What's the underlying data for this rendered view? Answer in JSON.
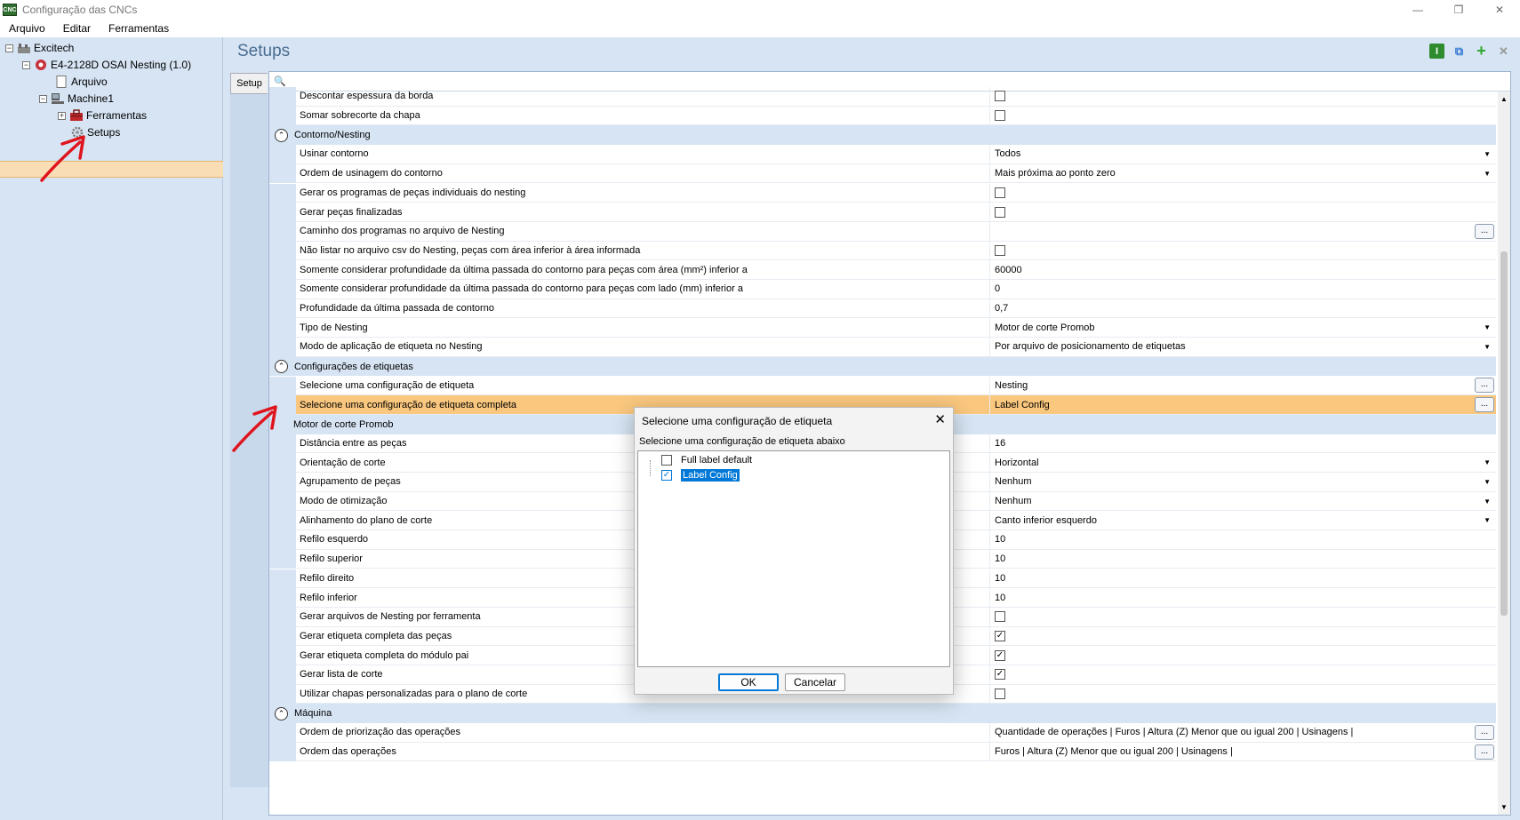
{
  "window": {
    "title": "Configuração das CNCs",
    "app_icon_text": "CNC"
  },
  "menu": [
    "Arquivo",
    "Editar",
    "Ferramentas"
  ],
  "tree": {
    "root": "Excitech",
    "machine": "E4-2128D OSAI Nesting (1.0)",
    "arquivo": "Arquivo",
    "machine1": "Machine1",
    "ferramentas": "Ferramentas",
    "setups": "Setups"
  },
  "header": {
    "title": "Setups"
  },
  "tab": {
    "label": "Setup"
  },
  "rows": [
    {
      "type": "prop",
      "label": "Descontar espessura da borda",
      "kind": "check",
      "checked": false
    },
    {
      "type": "prop",
      "label": "Somar sobrecorte da chapa",
      "kind": "check",
      "checked": false
    },
    {
      "type": "cat",
      "label": "Contorno/Nesting"
    },
    {
      "type": "prop",
      "label": "Usinar contorno",
      "kind": "dropdown",
      "value": "Todos"
    },
    {
      "type": "prop",
      "label": "Ordem de usinagem do contorno",
      "kind": "dropdown",
      "value": "Mais próxima ao ponto zero"
    },
    {
      "type": "prop",
      "label": "Gerar os programas de peças individuais do nesting",
      "kind": "check",
      "checked": false
    },
    {
      "type": "prop",
      "label": "Gerar peças finalizadas",
      "kind": "check",
      "checked": false
    },
    {
      "type": "prop",
      "label": "Caminho dos programas no arquivo de Nesting",
      "kind": "ellipsis",
      "value": ""
    },
    {
      "type": "prop",
      "label": "Não listar no arquivo csv do Nesting, peças com área inferior à área informada",
      "kind": "check",
      "checked": false
    },
    {
      "type": "prop",
      "label": "Somente considerar profundidade da última passada do contorno para peças com área (mm²) inferior a",
      "kind": "text",
      "value": "60000"
    },
    {
      "type": "prop",
      "label": "Somente considerar profundidade da última passada do contorno para peças com lado (mm) inferior a",
      "kind": "text",
      "value": "0"
    },
    {
      "type": "prop",
      "label": "Profundidade da última passada de contorno",
      "kind": "text",
      "value": "0,7"
    },
    {
      "type": "prop",
      "label": "Tipo de Nesting",
      "kind": "dropdown",
      "value": "Motor de corte Promob"
    },
    {
      "type": "prop",
      "label": "Modo de aplicação de etiqueta no Nesting",
      "kind": "dropdown",
      "value": "Por arquivo de posicionamento de etiquetas"
    },
    {
      "type": "cat",
      "label": "Configurações de etiquetas"
    },
    {
      "type": "prop",
      "label": "Selecione uma configuração de etiqueta",
      "kind": "ellipsis",
      "value": "Nesting"
    },
    {
      "type": "prop",
      "label": "Selecione uma configuração de etiqueta completa",
      "kind": "ellipsis",
      "value": "Label Config",
      "selected": true
    },
    {
      "type": "cat2",
      "label": "Motor de corte Promob"
    },
    {
      "type": "prop",
      "label": "Distância entre as peças",
      "kind": "text",
      "value": "16"
    },
    {
      "type": "prop",
      "label": "Orientação de corte",
      "kind": "dropdown",
      "value": "Horizontal"
    },
    {
      "type": "prop",
      "label": "Agrupamento de peças",
      "kind": "dropdown",
      "value": "Nenhum"
    },
    {
      "type": "prop",
      "label": "Modo de otimização",
      "kind": "dropdown",
      "value": "Nenhum"
    },
    {
      "type": "prop",
      "label": "Alinhamento do plano de corte",
      "kind": "dropdown",
      "value": "Canto inferior esquerdo"
    },
    {
      "type": "prop",
      "label": "Refilo esquerdo",
      "kind": "text",
      "value": "10"
    },
    {
      "type": "prop",
      "label": "Refilo superior",
      "kind": "text",
      "value": "10"
    },
    {
      "type": "prop",
      "label": "Refilo direito",
      "kind": "text",
      "value": "10"
    },
    {
      "type": "prop",
      "label": "Refilo inferior",
      "kind": "text",
      "value": "10"
    },
    {
      "type": "prop",
      "label": "Gerar arquivos de Nesting por ferramenta",
      "kind": "check",
      "checked": false
    },
    {
      "type": "prop",
      "label": "Gerar etiqueta completa das peças",
      "kind": "check",
      "checked": true
    },
    {
      "type": "prop",
      "label": "Gerar etiqueta completa do módulo pai",
      "kind": "check",
      "checked": true
    },
    {
      "type": "prop",
      "label": "Gerar lista de corte",
      "kind": "check",
      "checked": true
    },
    {
      "type": "prop",
      "label": "Utilizar chapas personalizadas para o plano de corte",
      "kind": "check",
      "checked": false
    },
    {
      "type": "cat",
      "label": "Máquina"
    },
    {
      "type": "prop",
      "label": "Ordem de priorização das operações",
      "kind": "ellipsis",
      "value": "Quantidade de operações | Furos | Altura (Z) Menor que ou igual 200 | Usinagens |"
    },
    {
      "type": "prop",
      "label": "Ordem das operações",
      "kind": "ellipsis",
      "value": "Furos | Altura (Z) Menor que ou igual 200 | Usinagens |"
    }
  ],
  "dialog": {
    "title": "Selecione uma configuração de etiqueta",
    "subtitle": "Selecione uma configuração de etiqueta abaixo",
    "items": [
      {
        "label": "Full label default",
        "checked": false
      },
      {
        "label": "Label Config",
        "checked": true,
        "highlighted": true
      }
    ],
    "ok": "OK",
    "cancel": "Cancelar"
  },
  "colors": {
    "panel": "#d6e4f3",
    "selected": "#f9c77e",
    "accent": "#0078d7",
    "arrow": "#e0141c"
  }
}
